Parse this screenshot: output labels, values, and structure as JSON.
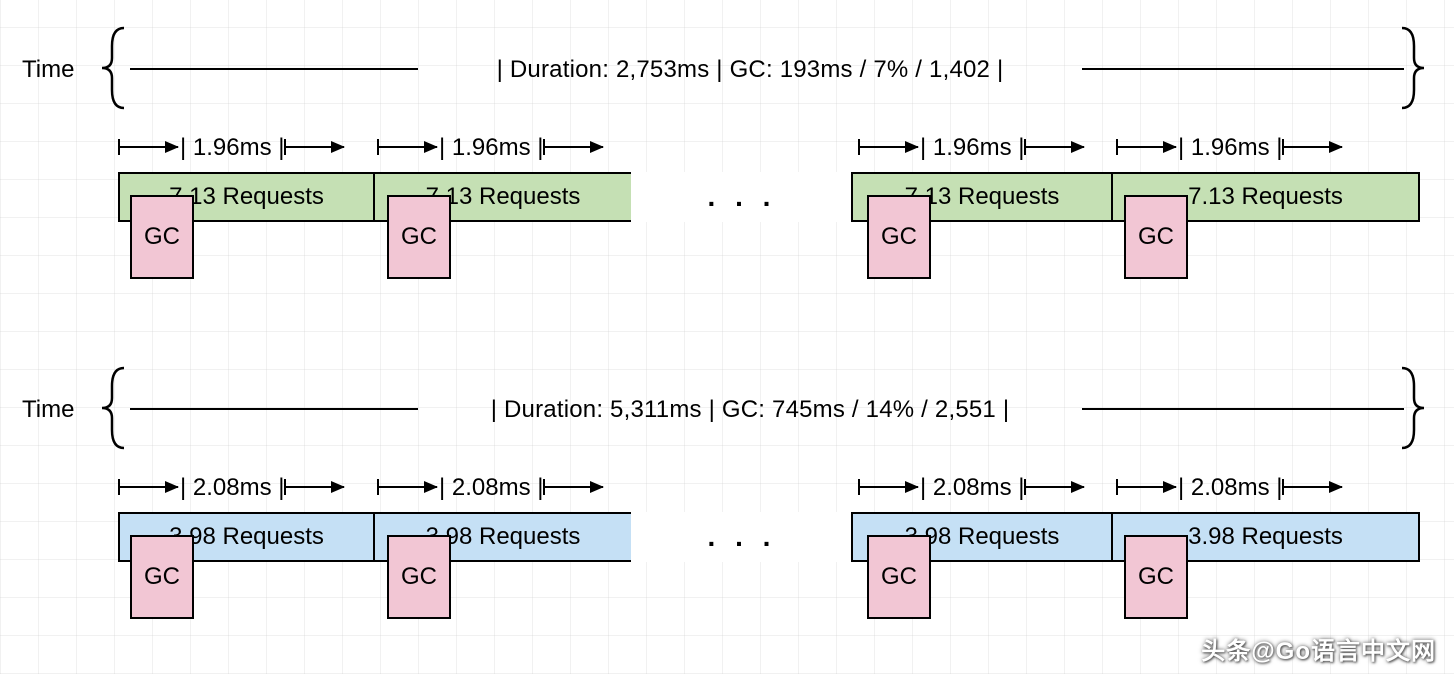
{
  "time_label": "Time",
  "gc_label": "GC",
  "ellipsis": ". . .",
  "watermark": "头条@Go语言中文网",
  "timelines": [
    {
      "summary": "| Duration: 2,753ms | GC: 193ms / 7% / 1,402 |",
      "interval_label": "| 1.96ms |",
      "request_label": "7.13 Requests",
      "color": "green"
    },
    {
      "summary": "| Duration: 5,311ms | GC: 745ms / 14% / 2,551 |",
      "interval_label": "| 2.08ms |",
      "request_label": "3.98 Requests",
      "color": "blue"
    }
  ],
  "chart_data": [
    {
      "type": "table",
      "title": "Timeline 1 (green)",
      "duration_ms": 2753,
      "gc_time_ms": 193,
      "gc_pct": 7,
      "gc_count": 1402,
      "interval_ms_per_segment": 1.96,
      "requests_per_segment": 7.13
    },
    {
      "type": "table",
      "title": "Timeline 2 (blue)",
      "duration_ms": 5311,
      "gc_time_ms": 745,
      "gc_pct": 14,
      "gc_count": 2551,
      "interval_ms_per_segment": 2.08,
      "requests_per_segment": 3.98
    }
  ]
}
